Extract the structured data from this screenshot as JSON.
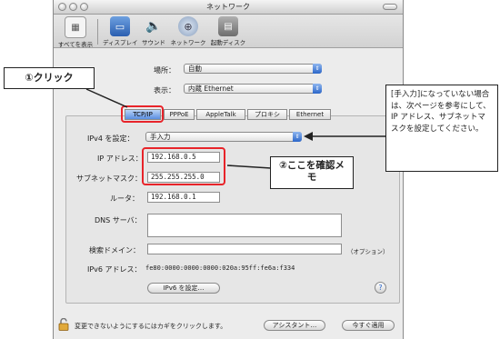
{
  "window": {
    "title": "ネットワーク"
  },
  "toolbar": {
    "items": [
      {
        "label": "すべてを表示",
        "icon": "show-all-icon"
      },
      {
        "label": "ディスプレイ",
        "icon": "display-icon"
      },
      {
        "label": "サウンド",
        "icon": "sound-icon"
      },
      {
        "label": "ネットワーク",
        "icon": "network-icon"
      },
      {
        "label": "起動ディスク",
        "icon": "startup-disk-icon"
      }
    ]
  },
  "location": {
    "label": "場所：",
    "value": "自動"
  },
  "show": {
    "label": "表示：",
    "value": "内蔵 Ethernet"
  },
  "tabs": [
    "TCP/IP",
    "PPPoE",
    "AppleTalk",
    "プロキシ",
    "Ethernet"
  ],
  "form": {
    "ipv4_label": "IPv4 を設定：",
    "ipv4_value": "手入力",
    "ip_label": "IP アドレス：",
    "ip_value": "192.168.0.5",
    "subnet_label": "サブネットマスク：",
    "subnet_value": "255.255.255.0",
    "router_label": "ルータ：",
    "router_value": "192.168.0.1",
    "dns_label": "DNS サーバ：",
    "search_label": "検索ドメイン：",
    "search_hint": "（オプション）",
    "ipv6_label": "IPv6 アドレス：",
    "ipv6_value": "fe80:0000:0000:0000:020a:95ff:fe6a:f334",
    "ipv6_button": "IPv6 を設定…",
    "help": "?"
  },
  "footer": {
    "lock_text": "変更できないようにするにはカギをクリックします。",
    "assistant": "アシスタント…",
    "apply": "今すぐ適用"
  },
  "annotations": {
    "click": "①クリック",
    "confirm": "②ここを確認メモ",
    "note": "[手入力]になっていない場合は、次ページを参考にして、IP アドレス、サブネットマスクを設定してください。"
  },
  "colors": {
    "red": "#e8242a",
    "accent": "#2b66c9"
  }
}
